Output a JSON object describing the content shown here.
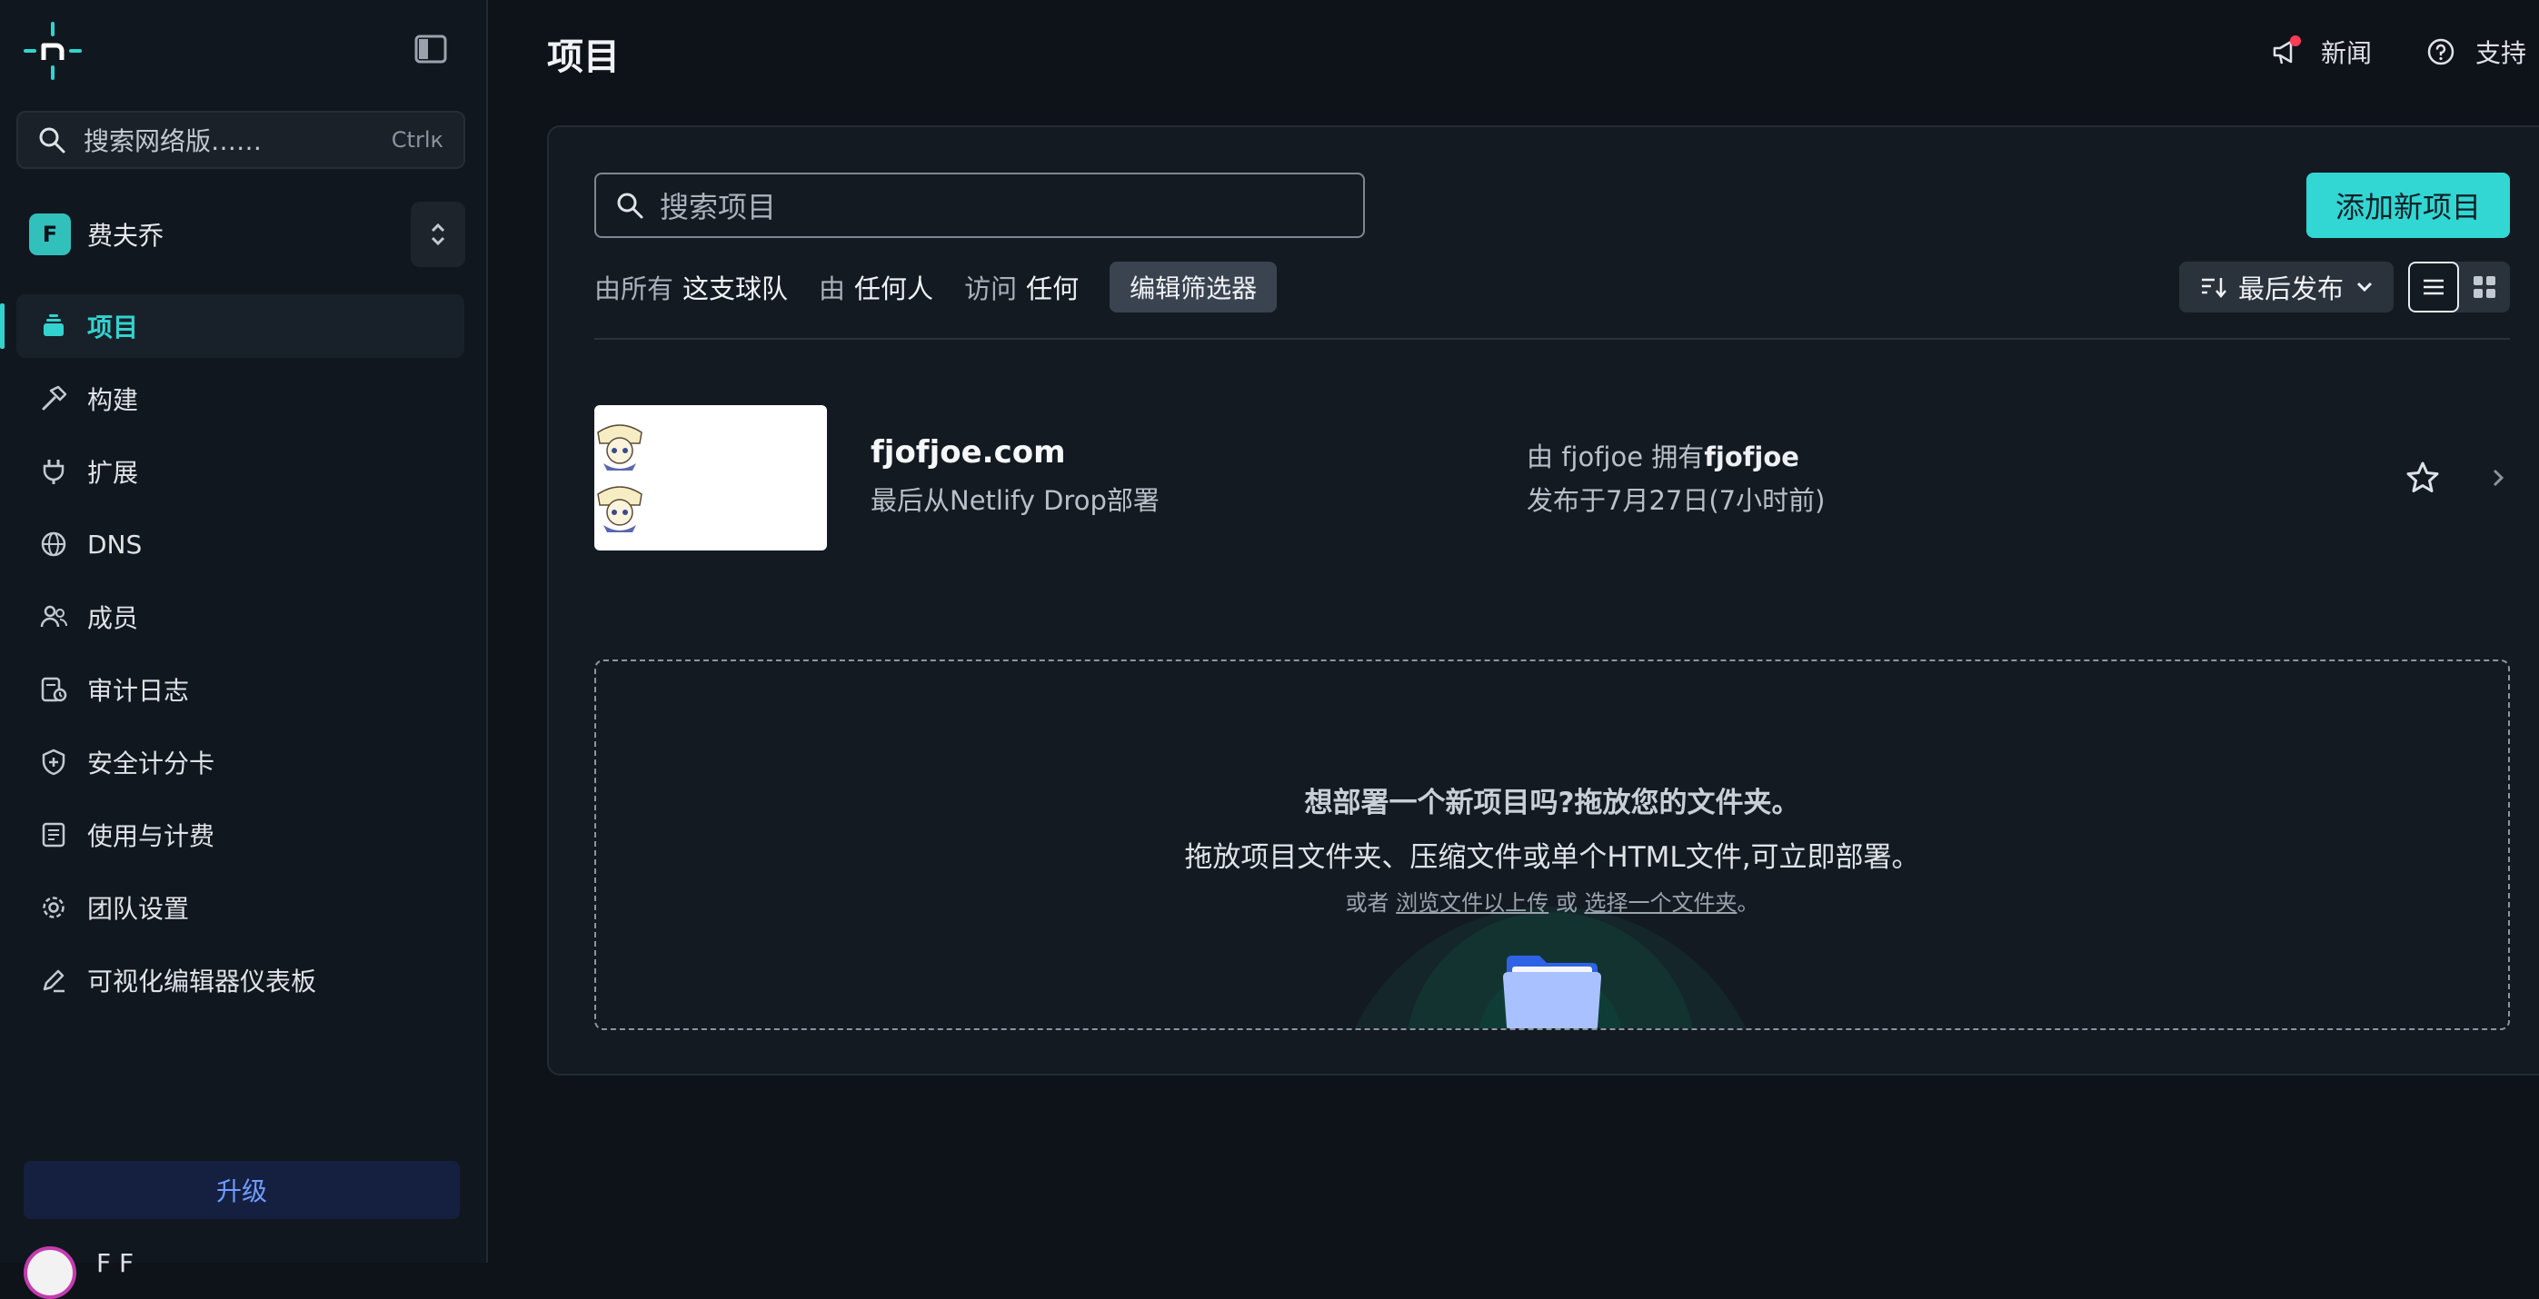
{
  "sidebar": {
    "search_placeholder": "搜索网络版……",
    "search_shortcut": "Ctrlк",
    "team": {
      "initial": "F",
      "name": "费夫乔"
    },
    "items": [
      {
        "label": "项目",
        "icon": "layers-icon",
        "active": true
      },
      {
        "label": "构建",
        "icon": "hammer-icon"
      },
      {
        "label": "扩展",
        "icon": "plug-icon"
      },
      {
        "label": "DNS",
        "icon": "globe-icon"
      },
      {
        "label": "成员",
        "icon": "users-icon"
      },
      {
        "label": "审计日志",
        "icon": "audit-log-icon"
      },
      {
        "label": "安全计分卡",
        "icon": "shield-icon"
      },
      {
        "label": "使用与计费",
        "icon": "receipt-icon"
      },
      {
        "label": "团队设置",
        "icon": "gear-icon"
      },
      {
        "label": "可视化编辑器仪表板",
        "icon": "pencil-icon"
      }
    ],
    "upgrade_label": "升级",
    "user_name_partial": "F F"
  },
  "header": {
    "title": "项目",
    "news_label": "新闻",
    "support_label": "支持"
  },
  "projects": {
    "search_placeholder": "搜索项目",
    "add_button": "添加新项目",
    "filters": {
      "by_all_label": "由所有",
      "by_all_value": "这支球队",
      "by_label": "由",
      "by_value": "任何人",
      "access_label": "访问",
      "access_value": "任何",
      "edit_label": "编辑筛选器"
    },
    "sort_label": "最后发布",
    "items": [
      {
        "name": "fjofjoe.com",
        "subtitle": "最后从Netlify Drop部署",
        "owner_prefix": "由 fjofjoe 拥有",
        "owner_bold": "fjofjoe",
        "published": "发布于7月27日(7小时前)"
      }
    ],
    "dropzone": {
      "title": "想部署一个新项目吗?拖放您的文件夹。",
      "subtitle": "拖放项目文件夹、压缩文件或单个HTML文件,可立即部署。",
      "or": "或者",
      "browse_link": "浏览文件以上传",
      "or2": "或",
      "choose_link": "选择一个文件夹",
      "period": "。"
    }
  },
  "colors": {
    "accent": "#32d6d3",
    "background": "#0e1319",
    "panel": "#131a21",
    "upgrade_text": "#6f9cff",
    "news_dot": "#ff3b57"
  }
}
